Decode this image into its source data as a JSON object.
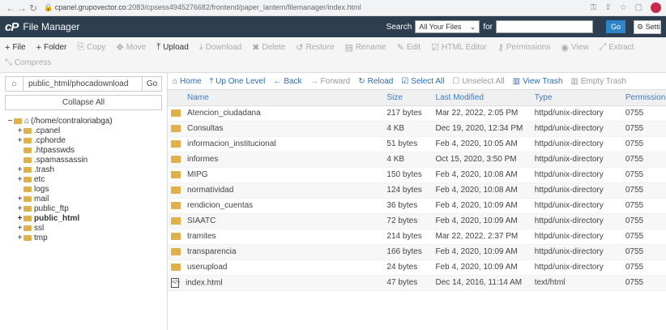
{
  "browser": {
    "url_host": "cpanel.grupovector.co",
    "url_path": ":2083/cpsess4945276682/frontend/paper_lantern/filemanager/index.html"
  },
  "header": {
    "title": "File Manager",
    "search_label": "Search",
    "search_scope": "All Your Files",
    "for_label": "for",
    "go_label": "Go",
    "settings_label": "Settings"
  },
  "toolbar": {
    "row1": [
      {
        "label": "File",
        "icon": "+",
        "active": true
      },
      {
        "label": "Folder",
        "icon": "+",
        "active": true
      },
      {
        "label": "Copy",
        "icon": "⎘",
        "active": false
      },
      {
        "label": "Move",
        "icon": "✥",
        "active": false
      },
      {
        "label": "Upload",
        "icon": "⤒",
        "active": true
      },
      {
        "label": "Download",
        "icon": "⤓",
        "active": false
      },
      {
        "label": "Delete",
        "icon": "✖",
        "active": false
      },
      {
        "label": "Restore",
        "icon": "↺",
        "active": false
      },
      {
        "label": "Rename",
        "icon": "▤",
        "active": false
      },
      {
        "label": "Edit",
        "icon": "✎",
        "active": false
      },
      {
        "label": "HTML Editor",
        "icon": "☑",
        "active": false
      },
      {
        "label": "Permissions",
        "icon": "⚷",
        "active": false
      },
      {
        "label": "View",
        "icon": "◉",
        "active": false
      },
      {
        "label": "Extract",
        "icon": "⤢",
        "active": false
      }
    ],
    "compress_label": "Compress"
  },
  "left": {
    "path_value": "public_html/phocadownload",
    "go_label": "Go",
    "collapse_label": "Collapse All",
    "tree": [
      {
        "label": "(/home/contraloriabga)",
        "toggle": "−",
        "indent": 0,
        "bold": false,
        "home": true
      },
      {
        "label": ".cpanel",
        "toggle": "+",
        "indent": 1,
        "bold": false
      },
      {
        "label": ".cphorde",
        "toggle": "+",
        "indent": 1,
        "bold": false
      },
      {
        "label": ".htpasswds",
        "toggle": "",
        "indent": 1,
        "bold": false
      },
      {
        "label": ".spamassassin",
        "toggle": "",
        "indent": 1,
        "bold": false
      },
      {
        "label": ".trash",
        "toggle": "+",
        "indent": 1,
        "bold": false
      },
      {
        "label": "etc",
        "toggle": "+",
        "indent": 1,
        "bold": false
      },
      {
        "label": "logs",
        "toggle": "",
        "indent": 1,
        "bold": false
      },
      {
        "label": "mail",
        "toggle": "+",
        "indent": 1,
        "bold": false
      },
      {
        "label": "public_ftp",
        "toggle": "+",
        "indent": 1,
        "bold": false
      },
      {
        "label": "public_html",
        "toggle": "+",
        "indent": 1,
        "bold": true
      },
      {
        "label": "ssl",
        "toggle": "+",
        "indent": 1,
        "bold": false
      },
      {
        "label": "tmp",
        "toggle": "+",
        "indent": 1,
        "bold": false
      }
    ]
  },
  "filebar": [
    {
      "label": "Home",
      "icon": "⌂",
      "dim": false
    },
    {
      "label": "Up One Level",
      "icon": "⤒",
      "dim": false
    },
    {
      "label": "Back",
      "icon": "←",
      "dim": false
    },
    {
      "label": "Forward",
      "icon": "→",
      "dim": true
    },
    {
      "label": "Reload",
      "icon": "↻",
      "dim": false
    },
    {
      "label": "Select All",
      "icon": "☑",
      "dim": false
    },
    {
      "label": "Unselect All",
      "icon": "☐",
      "dim": true
    },
    {
      "label": "View Trash",
      "icon": "▥",
      "dim": false
    },
    {
      "label": "Empty Trash",
      "icon": "▥",
      "dim": true
    }
  ],
  "columns": [
    "Name",
    "Size",
    "Last Modified",
    "Type",
    "Permissions"
  ],
  "files": [
    {
      "name": "Atencion_ciudadana",
      "size": "217 bytes",
      "modified": "Mar 22, 2022, 2:05 PM",
      "type": "httpd/unix-directory",
      "perm": "0755",
      "kind": "folder"
    },
    {
      "name": "Consultas",
      "size": "4 KB",
      "modified": "Dec 19, 2020, 12:34 PM",
      "type": "httpd/unix-directory",
      "perm": "0755",
      "kind": "folder"
    },
    {
      "name": "informacion_institucional",
      "size": "51 bytes",
      "modified": "Feb 4, 2020, 10:05 AM",
      "type": "httpd/unix-directory",
      "perm": "0755",
      "kind": "folder"
    },
    {
      "name": "informes",
      "size": "4 KB",
      "modified": "Oct 15, 2020, 3:50 PM",
      "type": "httpd/unix-directory",
      "perm": "0755",
      "kind": "folder"
    },
    {
      "name": "MIPG",
      "size": "150 bytes",
      "modified": "Feb 4, 2020, 10:08 AM",
      "type": "httpd/unix-directory",
      "perm": "0755",
      "kind": "folder"
    },
    {
      "name": "normatividad",
      "size": "124 bytes",
      "modified": "Feb 4, 2020, 10:08 AM",
      "type": "httpd/unix-directory",
      "perm": "0755",
      "kind": "folder"
    },
    {
      "name": "rendicion_cuentas",
      "size": "36 bytes",
      "modified": "Feb 4, 2020, 10:09 AM",
      "type": "httpd/unix-directory",
      "perm": "0755",
      "kind": "folder"
    },
    {
      "name": "SIAATC",
      "size": "72 bytes",
      "modified": "Feb 4, 2020, 10:09 AM",
      "type": "httpd/unix-directory",
      "perm": "0755",
      "kind": "folder"
    },
    {
      "name": "tramites",
      "size": "214 bytes",
      "modified": "Mar 22, 2022, 2:37 PM",
      "type": "httpd/unix-directory",
      "perm": "0755",
      "kind": "folder"
    },
    {
      "name": "transparencia",
      "size": "166 bytes",
      "modified": "Feb 4, 2020, 10:09 AM",
      "type": "httpd/unix-directory",
      "perm": "0755",
      "kind": "folder"
    },
    {
      "name": "userupload",
      "size": "24 bytes",
      "modified": "Feb 4, 2020, 10:09 AM",
      "type": "httpd/unix-directory",
      "perm": "0755",
      "kind": "folder"
    },
    {
      "name": "index.html",
      "size": "47 bytes",
      "modified": "Dec 14, 2016, 11:14 AM",
      "type": "text/html",
      "perm": "0755",
      "kind": "file"
    }
  ]
}
